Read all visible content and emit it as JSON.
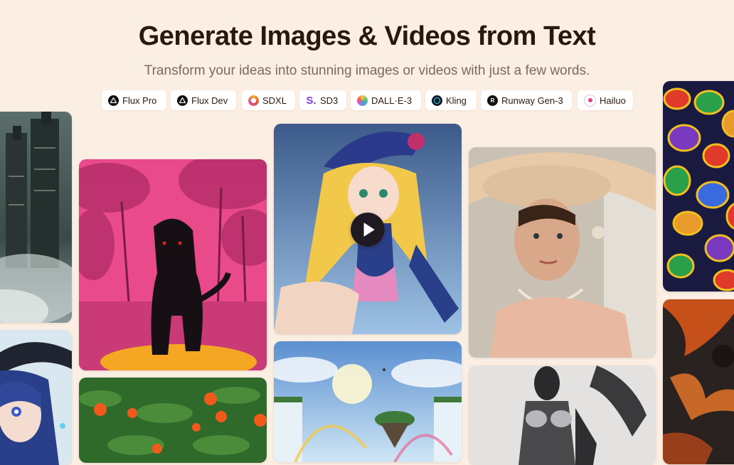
{
  "header": {
    "title": "Generate Images & Videos from Text",
    "subtitle": "Transform your ideas into stunning images or videos with just a few words."
  },
  "models": [
    {
      "label": "Flux Pro",
      "icon": "triangle-logo-icon"
    },
    {
      "label": "Flux Dev",
      "icon": "triangle-logo-icon"
    },
    {
      "label": "SDXL",
      "icon": "sdxl-logo-icon"
    },
    {
      "label": "SD3",
      "icon": "sd3-logo-icon"
    },
    {
      "label": "DALL·E-3",
      "icon": "dalle-logo-icon"
    },
    {
      "label": "Kling",
      "icon": "kling-logo-icon"
    },
    {
      "label": "Runway Gen-3",
      "icon": "runway-logo-icon"
    },
    {
      "label": "Hailuo",
      "icon": "hailuo-logo-icon"
    }
  ],
  "gallery": {
    "play_icon": "play-icon"
  },
  "colors": {
    "background": "#fbeee2",
    "title": "#2a1810",
    "subtitle": "#7d6a5f",
    "chip": "#ffffff",
    "sd3_accent": "#7b3fe4"
  }
}
